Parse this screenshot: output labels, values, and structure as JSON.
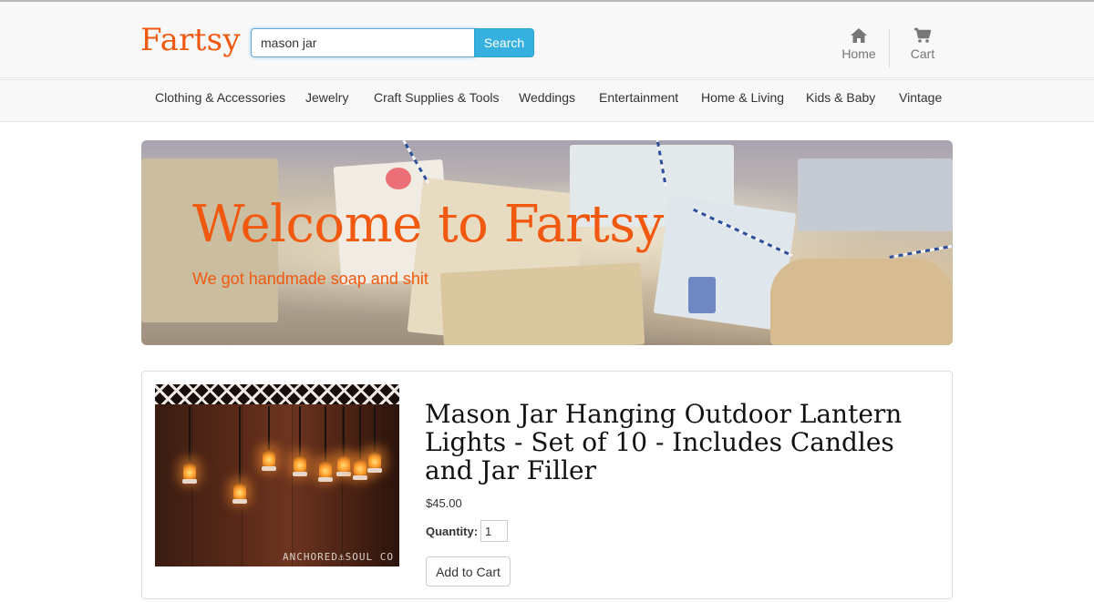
{
  "brand": {
    "name": "Fartsy",
    "color": "#f0590f"
  },
  "search": {
    "value": "mason jar",
    "button_label": "Search",
    "button_color": "#35b0df"
  },
  "header_nav": [
    {
      "label": "Home",
      "icon": "home-icon"
    },
    {
      "label": "Cart",
      "icon": "cart-icon"
    }
  ],
  "categories": [
    "Clothing & Accessories",
    "Jewelry",
    "Craft Supplies & Tools",
    "Weddings",
    "Entertainment",
    "Home & Living",
    "Kids & Baby",
    "Vintage"
  ],
  "hero": {
    "title": "Welcome to Fartsy",
    "subtitle": "We got handmade soap and shit"
  },
  "product": {
    "title": "Mason Jar Hanging Outdoor Lantern Lights - Set of 10 - Includes Candles and Jar Filler",
    "price": "$45.00",
    "quantity_label": "Quantity:",
    "quantity_value": "1",
    "add_to_cart_label": "Add to Cart",
    "image_watermark": "ANCHORED⚓SOUL CO"
  }
}
